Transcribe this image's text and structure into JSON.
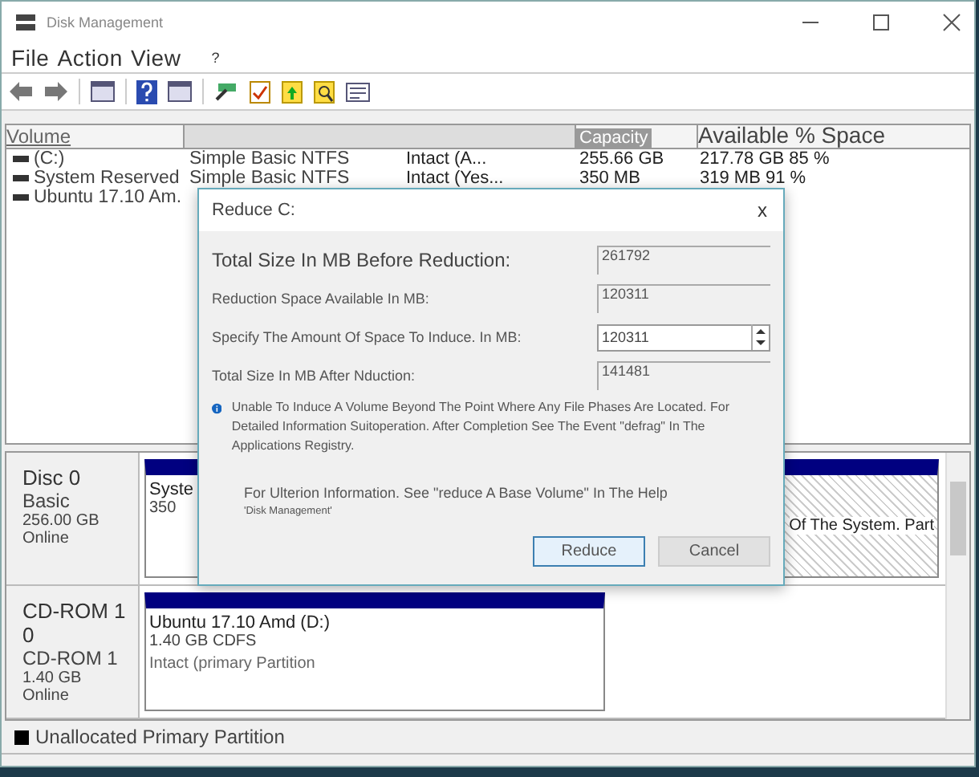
{
  "window": {
    "title": "Disk Management"
  },
  "menu": [
    {
      "label": "File"
    },
    {
      "label": "Action"
    },
    {
      "label": "View"
    },
    {
      "label": "?"
    }
  ],
  "table": {
    "columns": [
      "Volume",
      "Capacity",
      "Available % Space"
    ],
    "rows": [
      {
        "volume": "(C:)",
        "layout": "Simple Basic NTFS",
        "status": "Intact (A...",
        "capacity": "255.66 GB",
        "free": "217.78 GB 85 %"
      },
      {
        "volume": "System Reserved",
        "layout": "Simple Basic NTFS",
        "status": "Intact (Yes...",
        "capacity": "350 MB",
        "free": "319 MB 91 %"
      },
      {
        "volume": "Ubuntu 17.10 Am."
      }
    ]
  },
  "disks": [
    {
      "lines": [
        "Disc 0",
        "Basic",
        "256.00 GB",
        "Online"
      ],
      "partitions": [
        {
          "lines": [
            "Syste",
            "350"
          ],
          "hatched": false
        },
        {
          "lines": [
            "Of The System. Part"
          ],
          "hatched": true
        }
      ]
    },
    {
      "lines": [
        "CD-ROM 1 0",
        "CD-ROM 1",
        "1.40 GB",
        "Online"
      ],
      "partitions": [
        {
          "lines": [
            "Ubuntu 17.10 Amd (D:)",
            "1.40 GB CDFS",
            "Intact (primary Partition"
          ],
          "hatched": false
        }
      ]
    }
  ],
  "legend": [
    {
      "label": "Unallocated Primary Partition",
      "color": "#000000"
    }
  ],
  "dialog": {
    "title": "Reduce C:",
    "close": "x",
    "fields": [
      {
        "label": "Total Size In MB Before Reduction:",
        "value": "261792",
        "kind": "readonly"
      },
      {
        "label": "Reduction Space Available In MB:",
        "value": "120311",
        "kind": "readonly"
      },
      {
        "label": "Specify The Amount Of Space To Induce. In MB:",
        "value": "120311",
        "kind": "spinner"
      },
      {
        "label": "Total Size In MB After Nduction:",
        "value": "141481",
        "kind": "readonly"
      }
    ],
    "info": "Unable To Induce A Volume Beyond The Point Where Any File Phases Are Located. For Detailed Information Suitoperation. After Completion See The Event \"defrag\" In The Applications Registry.",
    "help": "For Ulterion Information. See \"reduce A Base Volume\" In The Help",
    "help_source": "'Disk Management'",
    "buttons": [
      {
        "label": "Reduce",
        "selected": true
      },
      {
        "label": "Cancel",
        "selected": false
      }
    ]
  }
}
